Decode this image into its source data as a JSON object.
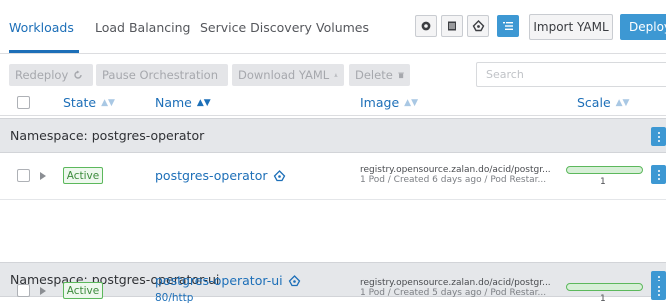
{
  "nav": {
    "tabs": [
      {
        "label": "Workloads",
        "active": true
      },
      {
        "label": "Load Balancing",
        "active": false
      },
      {
        "label": "Service Discovery",
        "active": false
      },
      {
        "label": "Volumes",
        "active": false
      }
    ],
    "view_icons": [
      "gear-icon",
      "list-icon",
      "stack-icon",
      "group-list-icon"
    ],
    "active_view": "group-list-icon",
    "import_label": "Import YAML",
    "deploy_label": "Deploy"
  },
  "actions": {
    "redeploy": "Redeploy",
    "pause": "Pause Orchestration",
    "download": "Download YAML",
    "delete": "Delete",
    "search_placeholder": "Search"
  },
  "columns": {
    "state": "State",
    "name": "Name",
    "image": "Image",
    "scale": "Scale"
  },
  "groups": [
    {
      "namespace": "Namespace: postgres-operator",
      "workloads": [
        {
          "state": "Active",
          "name": "postgres-operator",
          "port": "",
          "image": "registry.opensource.zalan.do/acid/postgr...",
          "detail": "1 Pod / Created 6 days ago / Pod Restar...",
          "scale": "1"
        }
      ]
    },
    {
      "namespace": "Namespace: postgres-operator-ui",
      "workloads": [
        {
          "state": "Active",
          "name": "postgres-operator-ui",
          "port": "80/http",
          "image": "registry.opensource.zalan.do/acid/postgr...",
          "detail": "1 Pod / Created 5 days ago / Pod Restar...",
          "scale": "1"
        }
      ]
    }
  ],
  "colors": {
    "accent": "#3d98d3",
    "link": "#1d6fb8",
    "active_green": "#5cb85c",
    "namespace_band": "#e5e7ea"
  }
}
